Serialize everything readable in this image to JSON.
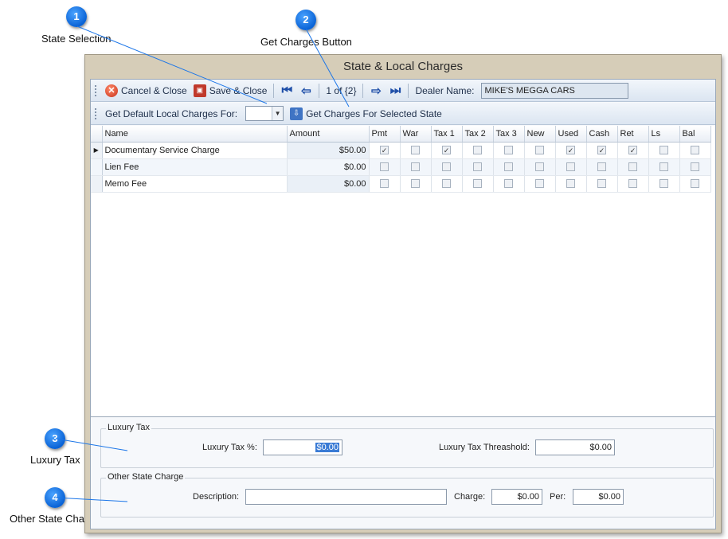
{
  "callouts": [
    {
      "number": "1",
      "label": "State Selection"
    },
    {
      "number": "2",
      "label": "Get Charges Button"
    },
    {
      "number": "3",
      "label": "Luxury Tax"
    },
    {
      "number": "4",
      "label": "Other State Charge"
    }
  ],
  "window": {
    "title": "State & Local Charges"
  },
  "toolbar1": {
    "cancel_label": "Cancel & Close",
    "save_label": "Save & Close",
    "record_position": "1 of {2}",
    "dealer_label": "Dealer Name:",
    "dealer_value": "MIKE'S MEGGA CARS"
  },
  "toolbar2": {
    "default_label": "Get Default Local Charges For:",
    "state_value": "",
    "get_charges_label": "Get Charges For Selected State"
  },
  "grid": {
    "columns": [
      "Name",
      "Amount",
      "Pmt",
      "War",
      "Tax 1",
      "Tax 2",
      "Tax 3",
      "New",
      "Used",
      "Cash",
      "Ret",
      "Ls",
      "Bal"
    ],
    "rows": [
      {
        "name": "Documentary Service Charge",
        "amount": "$50.00",
        "checks": [
          true,
          false,
          true,
          false,
          false,
          false,
          true,
          true,
          true,
          false,
          false
        ]
      },
      {
        "name": "Lien Fee",
        "amount": "$0.00",
        "checks": [
          false,
          false,
          false,
          false,
          false,
          false,
          false,
          false,
          false,
          false,
          false
        ]
      },
      {
        "name": "Memo Fee",
        "amount": "$0.00",
        "checks": [
          false,
          false,
          false,
          false,
          false,
          false,
          false,
          false,
          false,
          false,
          false
        ]
      }
    ],
    "current_row_marker": "▶"
  },
  "luxury_tax": {
    "title": "Luxury Tax",
    "percent_label": "Luxury Tax %:",
    "percent_value": "$0.00",
    "threshold_label": "Luxury Tax Threashold:",
    "threshold_value": "$0.00"
  },
  "other_state_charge": {
    "title": "Other State Charge",
    "description_label": "Description:",
    "description_value": "",
    "charge_label": "Charge:",
    "charge_value": "$0.00",
    "per_label": "Per:",
    "per_value": "$0.00"
  },
  "colors": {
    "callout": "#1a75e8",
    "window_frame": "#d6cdb8",
    "toolbar": "#dbe5f1"
  },
  "icons": {
    "cancel": "cancel-icon",
    "save": "save-icon",
    "first": "first-record-icon",
    "prev": "prev-record-icon",
    "next": "next-record-icon",
    "last": "last-record-icon",
    "get": "get-charges-icon",
    "dropdown": "chevron-down-icon"
  }
}
